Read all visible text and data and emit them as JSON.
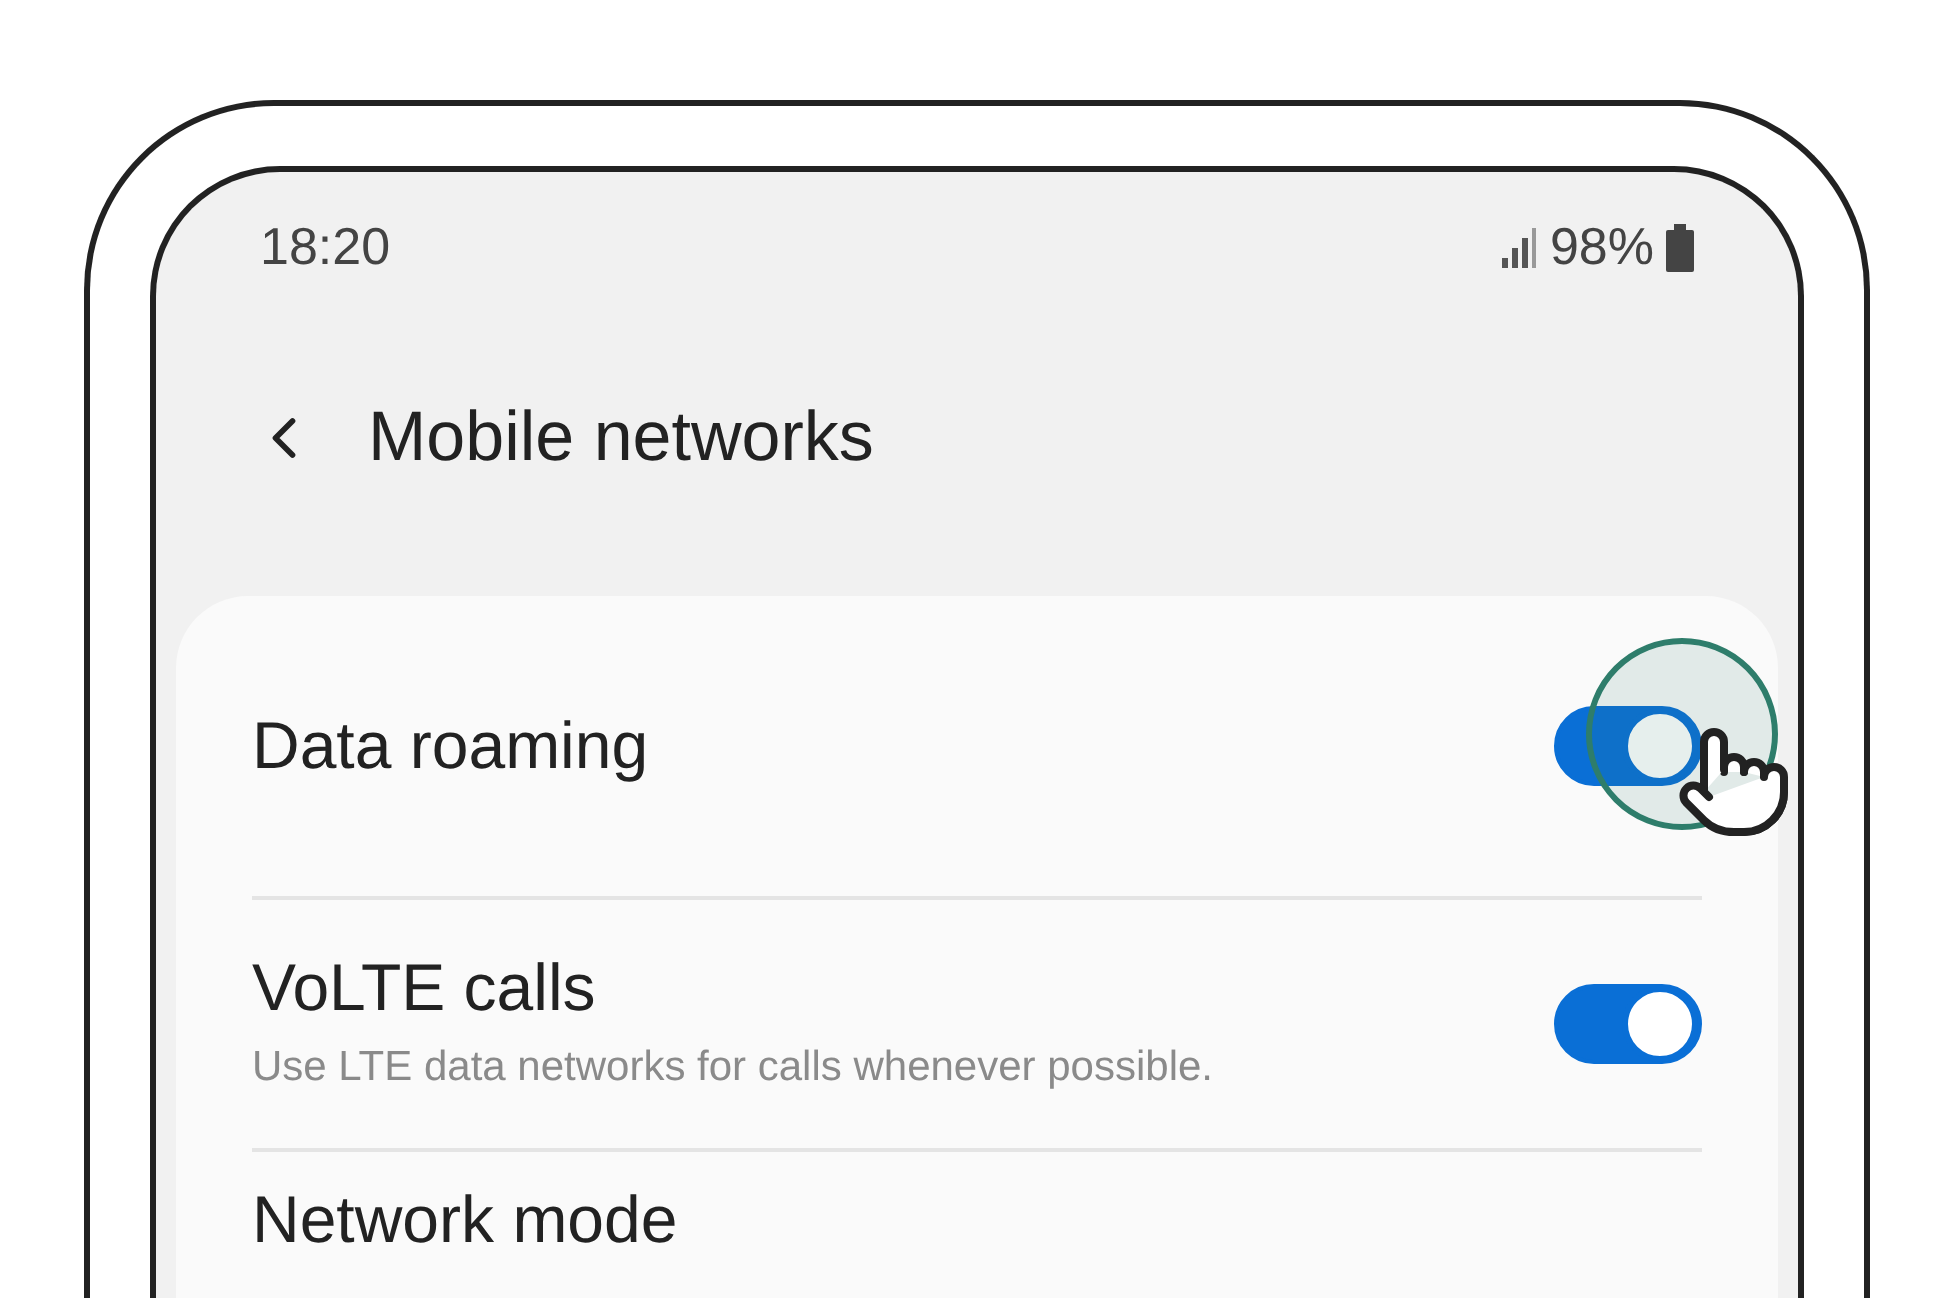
{
  "status_bar": {
    "time": "18:20",
    "battery": "98%"
  },
  "header": {
    "title": "Mobile networks"
  },
  "settings": [
    {
      "kind": "toggle",
      "title": "Data roaming",
      "on": true,
      "tapped": true
    },
    {
      "kind": "toggle",
      "title": "VoLTE calls",
      "description": "Use LTE data networks for calls whenever possible.",
      "on": true
    },
    {
      "kind": "plain",
      "title": "Network mode"
    }
  ]
}
